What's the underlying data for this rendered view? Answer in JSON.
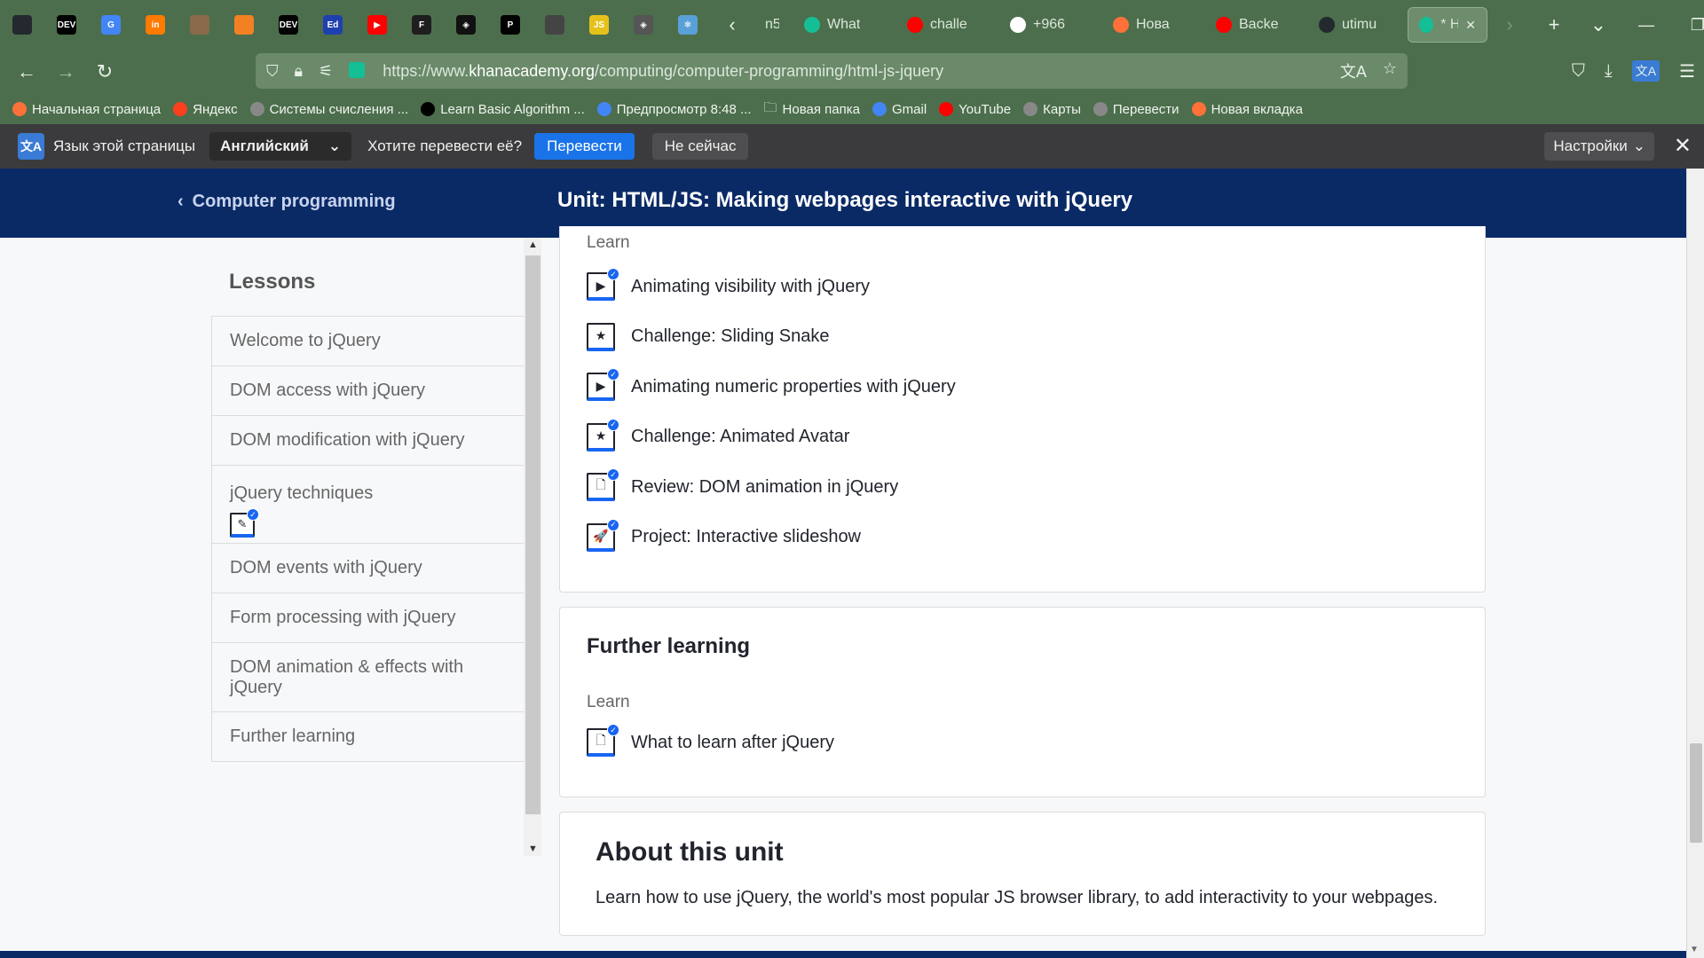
{
  "browser": {
    "pinned_tabs": [
      {
        "icon": "github-icon",
        "label": "",
        "color": "#24292f"
      },
      {
        "icon": "dev-icon",
        "label": "DEV",
        "color": "#000000"
      },
      {
        "icon": "google-translate-icon",
        "label": "G",
        "color": "#4285f4"
      },
      {
        "icon": "in-icon",
        "label": "in",
        "color": "#ff7a00"
      },
      {
        "icon": "avatar-icon",
        "label": "",
        "color": "#8a6a4a"
      },
      {
        "icon": "stack-icon",
        "label": "",
        "color": "#f48024"
      },
      {
        "icon": "dev-icon",
        "label": "DEV",
        "color": "#000000"
      },
      {
        "icon": "doc-icon",
        "label": "Ed",
        "color": "#1e40af"
      },
      {
        "icon": "youtube-icon",
        "label": "▶",
        "color": "#ff0000"
      },
      {
        "icon": "figma-icon",
        "label": "F",
        "color": "#1e1e1e"
      },
      {
        "icon": "codepen-icon",
        "label": "◈",
        "color": "#111111"
      },
      {
        "icon": "p-icon",
        "label": "P",
        "color": "#000000"
      },
      {
        "icon": "image-icon",
        "label": "",
        "color": "#444444"
      },
      {
        "icon": "js-icon",
        "label": "JS",
        "color": "#e5c21b"
      },
      {
        "icon": "codepen-icon",
        "label": "◈",
        "color": "#555555"
      },
      {
        "icon": "snowflake-icon",
        "label": "❄",
        "color": "#5aa0d8"
      }
    ],
    "tabs": [
      {
        "title": "n5",
        "icon_color": "transparent"
      },
      {
        "title": "What",
        "icon_color": "#14bf96"
      },
      {
        "title": "challe",
        "icon_color": "#ff0000"
      },
      {
        "title": "+966",
        "icon_color": "#ffffff"
      },
      {
        "title": "Нова",
        "icon_color": "#ff7139"
      },
      {
        "title": "Backe",
        "icon_color": "#ff0000"
      },
      {
        "title": "utimu",
        "icon_color": "#24292f"
      }
    ],
    "active_tab": {
      "title": "* H",
      "icon_color": "#14bf96"
    },
    "url_prefix": "https://www.",
    "url_domain": "khanacademy.org",
    "url_path": "/computing/computer-programming/html-js-jquery",
    "bookmarks": [
      {
        "label": "Начальная страница",
        "color": "#ff7139"
      },
      {
        "label": "Яндекс",
        "color": "#fc3f1d"
      },
      {
        "label": "Системы счисления ...",
        "color": "#888888"
      },
      {
        "label": "Learn Basic Algorithm ...",
        "color": "#000000"
      },
      {
        "label": "Предпросмотр  8:48  ...",
        "color": "#4285f4"
      },
      {
        "label": "Новая папка",
        "color": "transparent"
      },
      {
        "label": "Gmail",
        "color": "#4285f4"
      },
      {
        "label": "YouTube",
        "color": "#ff0000"
      },
      {
        "label": "Карты",
        "color": "#888888"
      },
      {
        "label": "Перевести",
        "color": "#888888"
      },
      {
        "label": "Новая вкладка",
        "color": "#ff7139"
      }
    ]
  },
  "translate_bar": {
    "prompt": "Язык этой страницы",
    "language": "Английский",
    "question": "Хотите перевести её?",
    "translate": "Перевести",
    "not_now": "Не сейчас",
    "settings": "Настройки"
  },
  "header": {
    "back_label": "Computer programming",
    "unit_title": "Unit: HTML/JS: Making webpages interactive with jQuery"
  },
  "sidebar": {
    "title": "Lessons",
    "lessons": [
      "Welcome to jQuery",
      "DOM access with jQuery",
      "DOM modification with jQuery",
      "jQuery techniques",
      "DOM events with jQuery",
      "Form processing with jQuery",
      "DOM animation & effects with jQuery",
      "Further learning"
    ]
  },
  "lesson_section": {
    "learn_label": "Learn",
    "items": [
      {
        "type": "video",
        "title": "Animating visibility with jQuery",
        "done": true
      },
      {
        "type": "challenge",
        "title": "Challenge: Sliding Snake",
        "done": false
      },
      {
        "type": "video",
        "title": "Animating numeric properties with jQuery",
        "done": true
      },
      {
        "type": "challenge",
        "title": "Challenge: Animated Avatar",
        "done": true
      },
      {
        "type": "article",
        "title": "Review: DOM animation in jQuery",
        "done": true
      },
      {
        "type": "project",
        "title": "Project: Interactive slideshow",
        "done": true
      }
    ]
  },
  "further_learning": {
    "title": "Further learning",
    "learn_label": "Learn",
    "items": [
      {
        "type": "article",
        "title": "What to learn after jQuery",
        "done": true
      }
    ]
  },
  "about": {
    "title": "About this unit",
    "text": "Learn how to use jQuery, the world's most popular JS browser library, to add interactivity to your webpages."
  },
  "colors": {
    "header_bg": "#0a2a66",
    "accent": "#1865f2",
    "browser_bg": "#4c6e4c"
  }
}
